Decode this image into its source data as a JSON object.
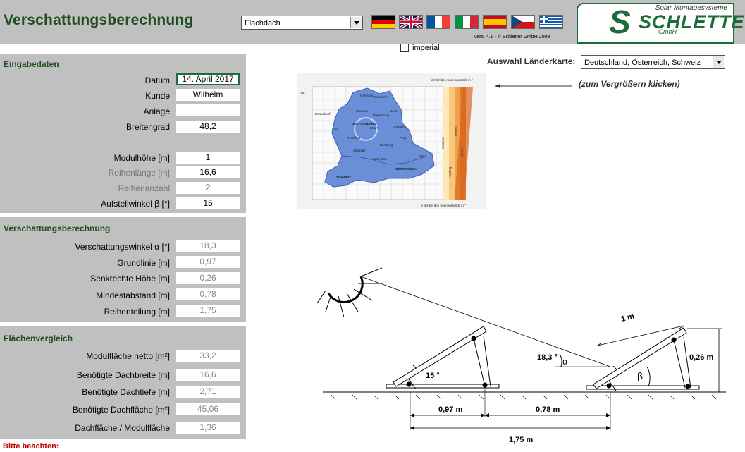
{
  "header": {
    "title": "Verschattungsberechnung",
    "roof_type": "Flachdach",
    "version": "Vers. 4.1 - © Schletter GmbH 2009",
    "flags": [
      "Deutsch",
      "English",
      "Français",
      "Italiano",
      "Español",
      "Čeština",
      "Ελληνικά"
    ],
    "logo": {
      "tagline": "Solar Montagesysteme",
      "name": "SCHLETTER",
      "suffix": "GmbH",
      "initial": "S"
    }
  },
  "units": {
    "imperial_label": "imperial",
    "imperial_checked": false
  },
  "country": {
    "label": "Auswahl Länderkarte:",
    "selected": "Deutschland, Österreich, Schweiz"
  },
  "map": {
    "hint": "(zum Vergrößern klicken)",
    "legend_top": "Winkel des Sonnenstands in °",
    "legend_bottom": "ø Winkel des Sonnenstands in °",
    "lat_label": "n.B.",
    "countries": [
      "DEUTSCHLAND",
      "ÖSTERREICH",
      "SCHWEIZ"
    ],
    "cities": [
      "Hamburg",
      "Schwerin",
      "Hannover",
      "Magdeburg",
      "Berlin",
      "Düsseldorf",
      "Erfurt",
      "Dresden",
      "Frankfurt",
      "Bamberg",
      "Prag",
      "Stuttgart",
      "München",
      "Wien",
      "Köln"
    ],
    "seasons": [
      "Sommer",
      "Frühling",
      "Herbst",
      "Winter"
    ]
  },
  "input": {
    "title": "Eingabedaten",
    "rows": [
      {
        "label": "Datum",
        "value": "14. April 2017"
      },
      {
        "label": "Kunde",
        "value": "Wilhelm"
      },
      {
        "label": "Anlage",
        "value": ""
      },
      {
        "label": "Breitengrad",
        "value": "48,2"
      },
      {
        "label": "Modulhöhe [m]",
        "value": "1"
      },
      {
        "label": "Reihenlänge [m]",
        "value": "16,6"
      },
      {
        "label": "Reihenanzahl",
        "value": "2"
      },
      {
        "label": "Aufstellwinkel β [°]",
        "value": "15"
      }
    ]
  },
  "calc": {
    "title": "Verschattungsberechnung",
    "rows": [
      {
        "label": "Verschattungswinkel α [°]",
        "value": "18,3"
      },
      {
        "label": "Grundlinie [m]",
        "value": "0,97"
      },
      {
        "label": "Senkrechte Höhe [m]",
        "value": "0,26"
      },
      {
        "label": "Mindestabstand [m]",
        "value": "0,78"
      },
      {
        "label": "Reihenteilung [m]",
        "value": "1,75"
      }
    ]
  },
  "area": {
    "title": "Flächenvergleich",
    "rows": [
      {
        "label": "Modulfläche netto [m²]",
        "value": "33,2"
      },
      {
        "label": "Benötigte Dachbreite [m]",
        "value": "16,6"
      },
      {
        "label": "Benötigte Dachtiefe [m]",
        "value": "2,71"
      },
      {
        "label": "Benötigte Dachfläche [m²]",
        "value": "45,06"
      },
      {
        "label": "Dachfläche / Modulfläche",
        "value": "1,36"
      }
    ]
  },
  "note": "Bitte beachten:",
  "diagram": {
    "angle_shadow": "18,3 °",
    "alpha": "α",
    "beta": "β",
    "tilt": "15 °",
    "module_len": "1 m",
    "height": "0,26 m",
    "base": "0,97 m",
    "gap": "0,78 m",
    "pitch": "1,75 m"
  },
  "colors": {
    "panel_bg": "#c0c0c0",
    "title_green": "#1f4e1f",
    "logo_green": "#1f6b3a",
    "note_red": "#c00000"
  }
}
